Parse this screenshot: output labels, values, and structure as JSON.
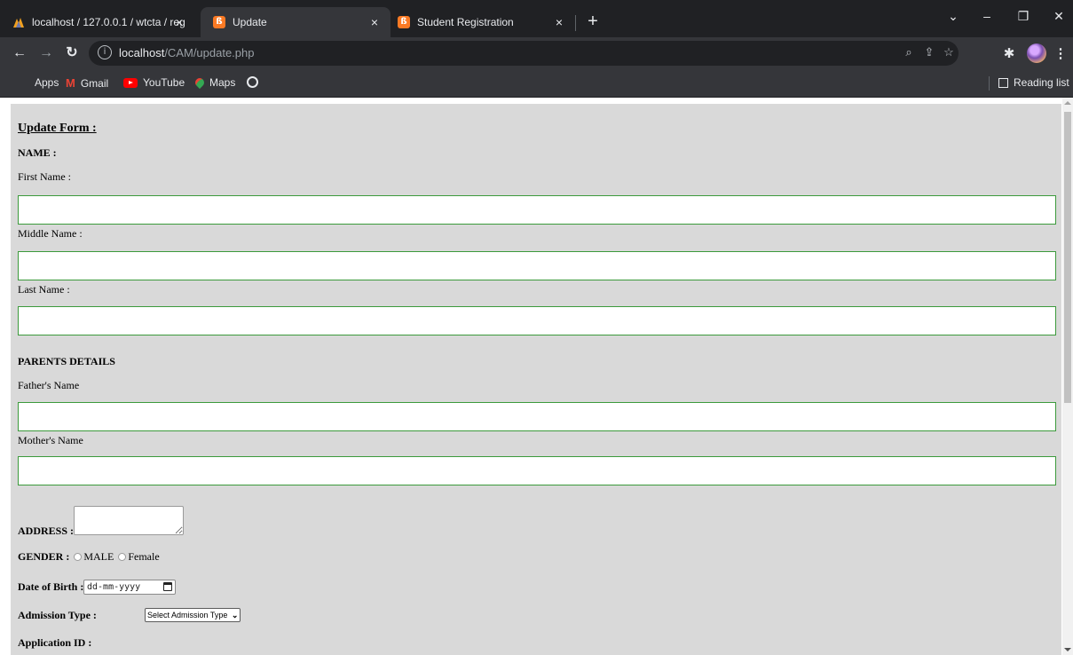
{
  "browser": {
    "tabs": [
      {
        "title": "localhost / 127.0.0.1 / wtcta / reg",
        "active": false,
        "icon": "phpmyadmin-icon"
      },
      {
        "title": "Update",
        "active": true,
        "icon": "xampp-icon"
      },
      {
        "title": "Student Registration",
        "active": false,
        "icon": "xampp-icon"
      }
    ],
    "tab_close_glyph": "×",
    "new_tab_glyph": "+",
    "url": {
      "host": "localhost",
      "path": "/CAM/update.php"
    },
    "bookmarks": [
      {
        "label": "Apps",
        "icon": "apps-grid-icon"
      },
      {
        "label": "Gmail",
        "icon": "gmail-icon"
      },
      {
        "label": "YouTube",
        "icon": "youtube-icon"
      },
      {
        "label": "Maps",
        "icon": "maps-icon"
      }
    ],
    "reading_list": "Reading list"
  },
  "form": {
    "title": "Update Form :",
    "name_heading": "NAME :",
    "first_name_label": "First Name :",
    "middle_name_label": "Middle Name :",
    "last_name_label": "Last Name :",
    "parents_heading": "PARENTS DETAILS",
    "father_label": "Father's Name",
    "mother_label": "Mother's Name",
    "address_label": "ADDRESS :",
    "gender_label": "GENDER :",
    "gender_options": [
      "MALE",
      "Female"
    ],
    "dob_label": "Date of Birth :",
    "dob_placeholder": "dd-mm-yyyy",
    "admission_label": "Admission Type :",
    "admission_selected": "Select Admission Type",
    "application_id_label": "Application ID :"
  },
  "colors": {
    "page_bg": "#d9d9d9",
    "input_border": "#3c9a3c",
    "chrome_dark": "#202124",
    "chrome_toolbar": "#35363a"
  }
}
